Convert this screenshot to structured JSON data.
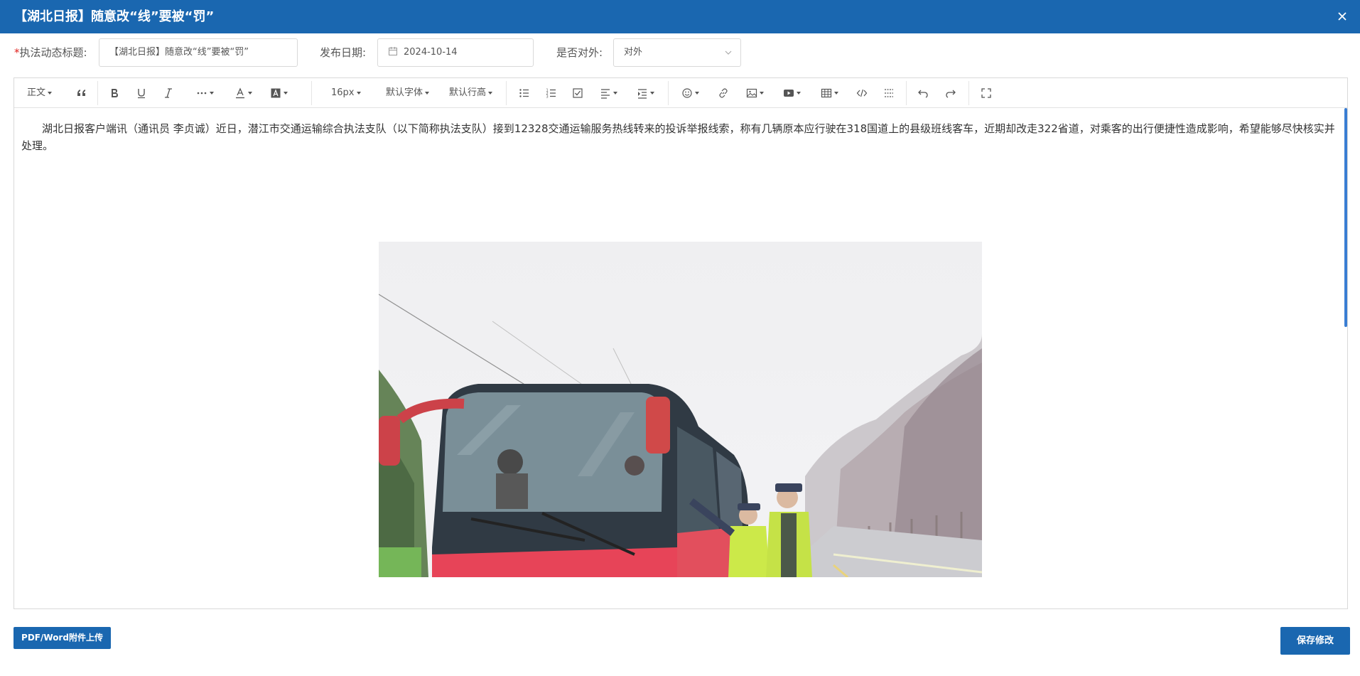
{
  "dialog": {
    "title": "【湖北日报】随意改“线”要被“罚”"
  },
  "form": {
    "required_mark": "*",
    "title_label": "执法动态标题:",
    "title_value": "【湖北日报】随意改“线”要被“罚”",
    "date_label": "发布日期:",
    "date_value": "2024-10-14",
    "external_label": "是否对外:",
    "external_value": "对外"
  },
  "toolbar": {
    "heading": "正文",
    "font_size": "16px",
    "font_family": "默认字体",
    "line_height": "默认行高",
    "icons": [
      "quote-icon",
      "bold-icon",
      "underline-icon",
      "italic-icon",
      "more-icon",
      "font-color-icon",
      "bg-color-icon",
      "bullet-list-icon",
      "numbered-list-icon",
      "todo-icon",
      "align-icon",
      "indent-icon",
      "emoji-icon",
      "link-icon",
      "image-icon",
      "video-icon",
      "table-icon",
      "code-icon",
      "divider-icon",
      "undo-icon",
      "redo-icon",
      "fullscreen-icon"
    ]
  },
  "content": {
    "paragraph": "湖北日报客户端讯（通讯员 李贞诚）近日，潜江市交通运输综合执法支队（以下简称执法支队）接到12328交通运输服务热线转来的投诉举报线索，称有几辆原本应行驶在318国道上的县级班线客车，近期却改走322省道，对乘客的出行便捷性造成影响，希望能够尽快核实并处理。"
  },
  "buttons": {
    "upload": "PDF/Word附件上传",
    "save": "保存修改"
  },
  "colors": {
    "primary": "#1a67b0",
    "required": "#e0201d"
  }
}
